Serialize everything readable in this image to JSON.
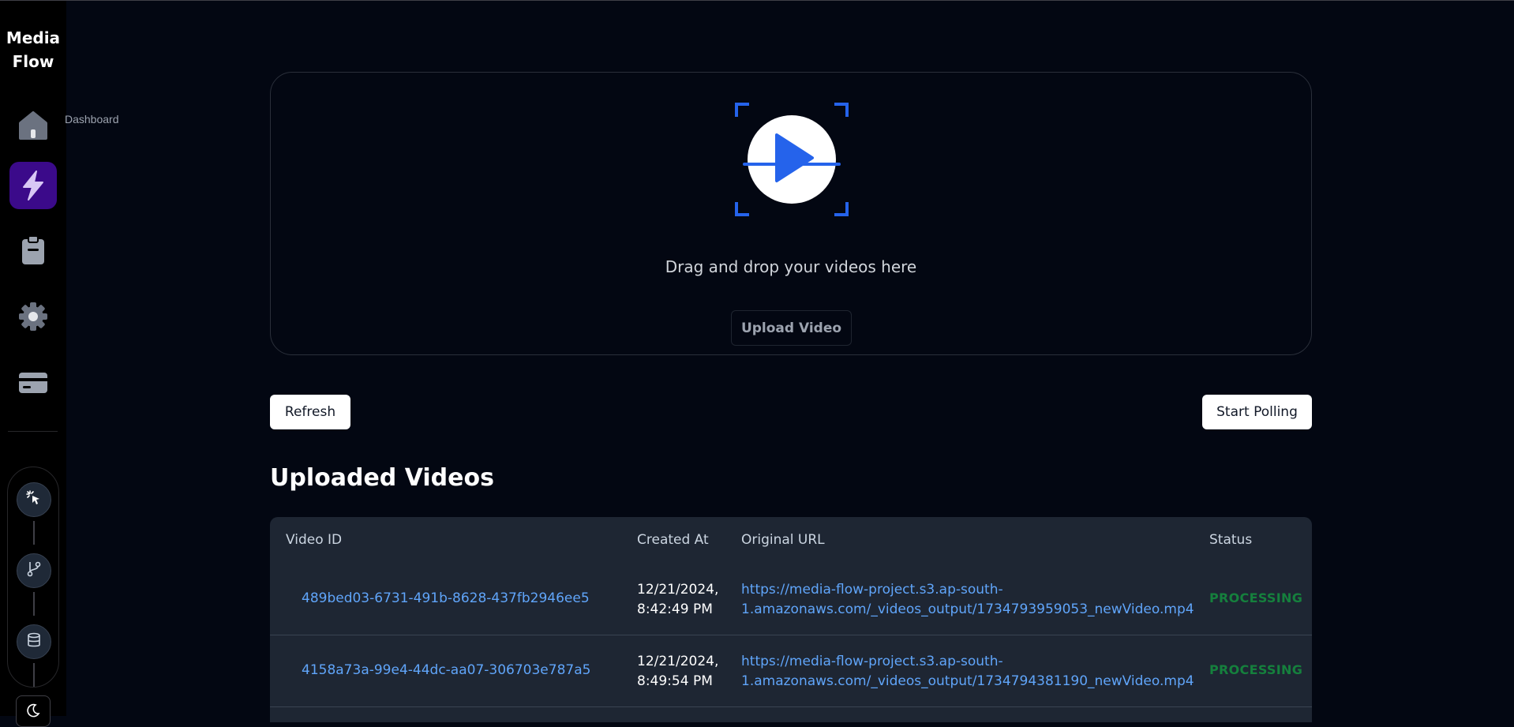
{
  "app": {
    "brand": "Media Flow"
  },
  "sidebar": {
    "items": [
      {
        "name": "home-icon",
        "tooltip": "Dashboard"
      },
      {
        "name": "lightning-icon"
      },
      {
        "name": "clipboard-icon"
      },
      {
        "name": "gear-icon"
      },
      {
        "name": "credit-card-icon"
      }
    ],
    "tools": [
      "pointer-sparkle-icon",
      "git-branch-icon",
      "database-icon"
    ],
    "theme": "moon-icon"
  },
  "upload": {
    "drop_text": "Drag and drop your videos here",
    "button_label": "Upload Video"
  },
  "actions": {
    "refresh_label": "Refresh",
    "polling_label": "Start Polling"
  },
  "videos": {
    "title": "Uploaded Videos",
    "columns": [
      "Video ID",
      "Created At",
      "Original URL",
      "Status"
    ],
    "rows": [
      {
        "id": "489bed03-6731-491b-8628-437fb2946ee5",
        "date_line1": "12/21/2024,",
        "date_line2": "8:42:49 PM",
        "url_line1": "https://media-flow-project.s3.ap-south-",
        "url_line2": "1.amazonaws.com/_videos_output/1734793959053_newVideo.mp4",
        "status": "PROCESSING"
      },
      {
        "id": "4158a73a-99e4-44dc-aa07-306703e787a5",
        "date_line1": "12/21/2024,",
        "date_line2": "8:49:54 PM",
        "url_line1": "https://media-flow-project.s3.ap-south-",
        "url_line2": "1.amazonaws.com/_videos_output/1734794381190_newVideo.mp4",
        "status": "PROCESSING"
      }
    ]
  },
  "colors": {
    "accent": "#2563eb",
    "link": "#60a5fa",
    "status_processing": "#15803d",
    "active_nav": "#3b0a8a"
  }
}
